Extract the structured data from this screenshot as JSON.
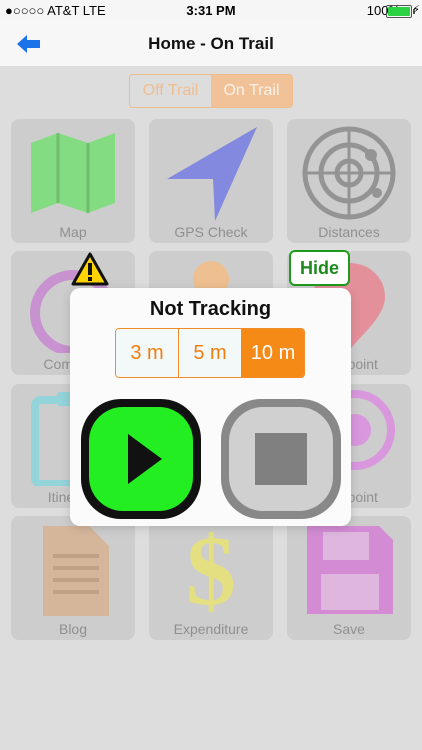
{
  "status_bar": {
    "carrier": "●○○○○ AT&T  LTE",
    "time": "3:31 PM",
    "battery": "100%"
  },
  "nav": {
    "title": "Home - On Trail"
  },
  "mode_toggle": {
    "off_label": "Off Trail",
    "on_label": "On Trail",
    "selected": "On Trail"
  },
  "tiles": [
    {
      "label": "Map"
    },
    {
      "label": "GPS Check"
    },
    {
      "label": "Distances"
    },
    {
      "label": "Compass"
    },
    {
      "label": ""
    },
    {
      "label": "Waypoint"
    },
    {
      "label": "Itinerary"
    },
    {
      "label": ""
    },
    {
      "label": "Waypoint"
    },
    {
      "label": "Blog"
    },
    {
      "label": "Expenditure"
    },
    {
      "label": "Save"
    }
  ],
  "hide_button": {
    "label": "Hide"
  },
  "dialog": {
    "title": "Not Tracking",
    "distances": [
      "3 m",
      "5 m",
      "10 m"
    ],
    "selected_distance": "10 m"
  },
  "colors": {
    "accent": "#f68a17",
    "play": "#22ee22",
    "hide": "#1e9b1e"
  }
}
